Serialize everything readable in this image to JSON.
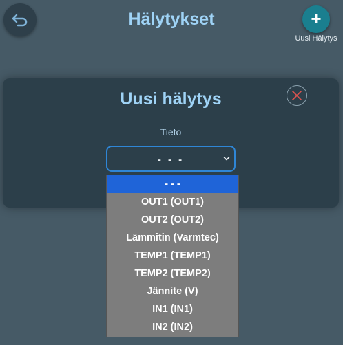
{
  "header": {
    "title": "Hälytykset",
    "new_button_label": "Uusi Hälytys"
  },
  "modal": {
    "title": "Uusi hälytys",
    "field_label": "Tieto",
    "select_value": "- - -"
  },
  "dropdown": {
    "options": [
      "- - -",
      "OUT1 (OUT1)",
      "OUT2 (OUT2)",
      "Lämmitin (Varmtec)",
      "TEMP1 (TEMP1)",
      "TEMP2 (TEMP2)",
      "Jännite (V)",
      "IN1 (IN1)",
      "IN2 (IN2)"
    ],
    "selected_index": 0
  },
  "icons": {
    "back": "back-arrow-icon",
    "add": "plus-icon",
    "close": "close-icon",
    "select": "chevron-down-icon"
  },
  "colors": {
    "background": "#465a66",
    "title": "#9fd3f6",
    "accent": "#1a7f8f",
    "close": "#d9534f",
    "selected_option": "#1f64d8"
  }
}
